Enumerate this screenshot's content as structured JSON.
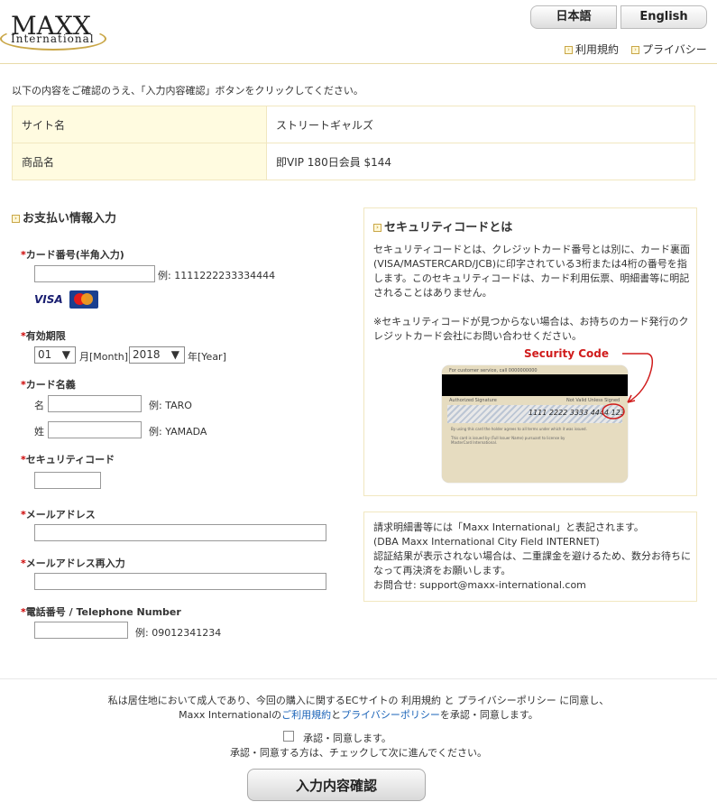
{
  "header": {
    "logo_main": "MAXX",
    "logo_sub": "International",
    "lang_ja": "日本語",
    "lang_en": "English",
    "terms_link": "利用規約",
    "privacy_link": "プライバシー"
  },
  "intro": "以下の内容をご確認のうえ、「入力内容確認」ボタンをクリックしてください。",
  "info": {
    "site_label": "サイト名",
    "site_value": "ストリートギャルズ",
    "product_label": "商品名",
    "product_value": "即VIP 180日会員 $144"
  },
  "payment": {
    "title": "お支払い情報入力",
    "card_number_label": "カード番号(半角入力)",
    "card_number_example": "例: 1111222233334444",
    "visa": "VISA",
    "mastercard": "MasterCard",
    "expiry_label": "有効期限",
    "month_value": "01",
    "month_unit": "月[Month]",
    "year_value": "2018",
    "year_unit": "年[Year]",
    "name_label": "カード名義",
    "first_name_label": "名",
    "first_name_example": "例: TARO",
    "last_name_label": "姓",
    "last_name_example": "例: YAMADA",
    "security_label": "セキュリティコード",
    "email_label": "メールアドレス",
    "email_confirm_label": "メールアドレス再入力",
    "phone_label": "電話番号 / Telephone Number",
    "phone_example": "例: 09012341234"
  },
  "security_panel": {
    "title": "セキュリティコードとは",
    "text1": "セキュリティコードとは、クレジットカード番号とは別に、カード裏面(VISA/MASTERCARD/JCB)に印字されている3桁または4桁の番号を指します。このセキュリティコードは、カード利用伝票、明細書等に明記されることはありません。",
    "text2": "※セキュリティコードが見つからない場合は、お持ちのカード発行のクレジットカード会社にお問い合わせください。",
    "callout": "Security Code",
    "card_top": "For customer service, call 0000000000",
    "card_sig": "Authorized Signature",
    "card_valid": "Not Valid Unless Signed",
    "card_number": "1111 2222 3333 4444 123",
    "card_fine1": "By using this card the holder agrees to all terms under which it was issued.",
    "card_fine2": "This card is issued by (Full Issuer Name) pursuant to license by MasterCard International."
  },
  "billing_panel": {
    "line1": "請求明細書等には「Maxx International」と表記されます。",
    "line2": "(DBA Maxx International City Field INTERNET)",
    "line3": "認証結果が表示されない場合は、二重課金を避けるため、数分お待ちになって再決済をお願いします。",
    "line4": "お問合せ: support@maxx-international.com"
  },
  "agreement": {
    "line1": "私は居住地において成人であり、今回の購入に関するECサイトの 利用規約 と プライバシーポリシー に同意し、",
    "line2_pre": "Maxx Internationalの",
    "line2_link1": "ご利用規約",
    "line2_mid": "と",
    "line2_link2": "プライバシーポリシー",
    "line2_post": "を承認・同意します。",
    "checkbox_label": "承認・同意します。",
    "note": "承認・同意する方は、チェックして次に進んでください。",
    "confirm_button": "入力内容確認"
  }
}
